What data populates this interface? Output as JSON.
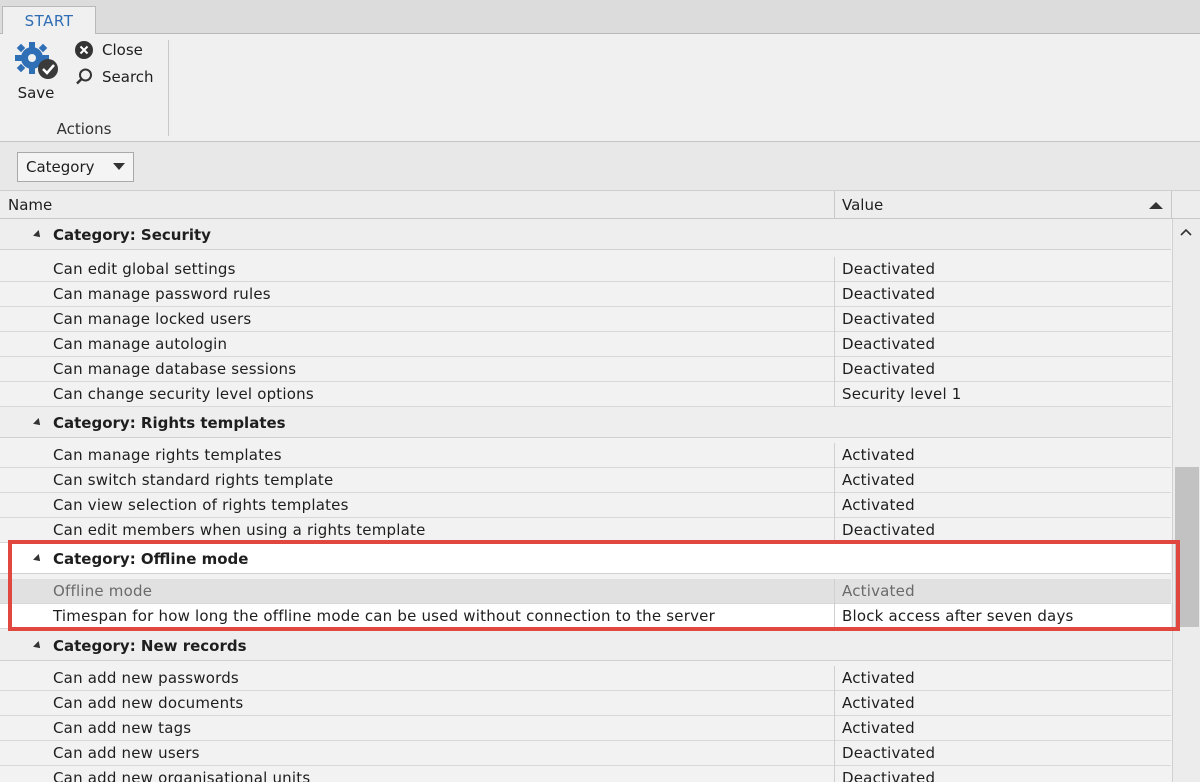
{
  "ribbon": {
    "tab": "START",
    "save_label": "Save",
    "close_label": "Close",
    "search_label": "Search",
    "group_label": "Actions"
  },
  "toolbar": {
    "category_label": "Category"
  },
  "grid": {
    "columns": {
      "name": "Name",
      "value": "Value"
    },
    "groups": [
      {
        "title": "Category: Security",
        "rows": [
          {
            "name": "Can edit global settings",
            "value": "Deactivated"
          },
          {
            "name": "Can manage password rules",
            "value": "Deactivated"
          },
          {
            "name": "Can manage locked users",
            "value": "Deactivated"
          },
          {
            "name": "Can manage autologin",
            "value": "Deactivated"
          },
          {
            "name": "Can manage database sessions",
            "value": "Deactivated"
          },
          {
            "name": "Can change security level options",
            "value": "Security level 1"
          }
        ]
      },
      {
        "title": "Category: Rights templates",
        "rows": [
          {
            "name": "Can manage rights templates",
            "value": "Activated"
          },
          {
            "name": "Can switch standard rights template",
            "value": "Activated"
          },
          {
            "name": "Can view selection of rights templates",
            "value": "Activated"
          },
          {
            "name": "Can edit members when using a rights template",
            "value": "Deactivated"
          }
        ]
      },
      {
        "title": "Category: Offline mode",
        "rows": [
          {
            "name": "Offline mode",
            "value": "Activated"
          },
          {
            "name": "Timespan for how long the offline mode can be used without connection to the server",
            "value": "Block access after seven days"
          }
        ]
      },
      {
        "title": "Category: New records",
        "rows": [
          {
            "name": "Can add new passwords",
            "value": "Activated"
          },
          {
            "name": "Can add new documents",
            "value": "Activated"
          },
          {
            "name": "Can add new tags",
            "value": "Activated"
          },
          {
            "name": "Can add new users",
            "value": "Deactivated"
          },
          {
            "name": "Can add new organisational units",
            "value": "Deactivated"
          }
        ]
      }
    ]
  },
  "colors": {
    "accent": "#2e6db4",
    "highlight": "#e0473f"
  }
}
